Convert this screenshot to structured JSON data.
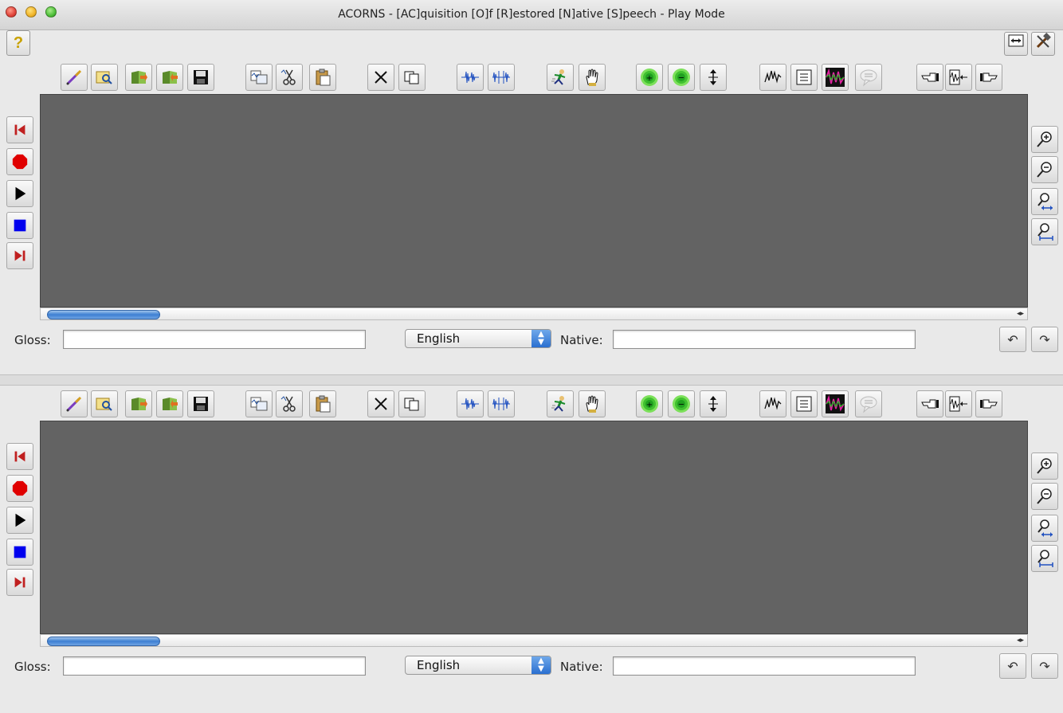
{
  "window": {
    "title": "ACORNS - [AC]quisition [O]f [R]estored [N]ative [S]peech - Play Mode"
  },
  "top_bar": {
    "help_icon": "help-question-icon",
    "fit_icon": "fit-width-icon",
    "tools_icon": "tools-hammer-icon"
  },
  "panels": [
    {
      "gloss_label": "Gloss:",
      "gloss_value": "",
      "language": "English",
      "native_label": "Native:",
      "native_value": ""
    },
    {
      "gloss_label": "Gloss:",
      "gloss_value": "",
      "language": "English",
      "native_label": "Native:",
      "native_value": ""
    }
  ],
  "toolbar_icons": [
    "clear-icon",
    "find-icon",
    "import-icon",
    "export-icon",
    "save-icon",
    "convert-icon",
    "cut-audio-icon",
    "paste-audio-icon",
    "delete-icon",
    "copy-icon",
    "compress-wave-icon",
    "expand-wave-icon",
    "run-icon",
    "hand-icon",
    "amplify-icon",
    "attenuate-icon",
    "normalize-icon",
    "pitch-icon",
    "annotation-icon",
    "spectrum-icon",
    "speech-bubble-icon",
    "point-left-icon",
    "wave-marker-icon",
    "point-right-icon"
  ],
  "playback_icons": [
    "go-start-icon",
    "record-icon",
    "play-icon",
    "stop-icon",
    "go-end-icon"
  ],
  "zoom_icons": [
    "zoom-in-icon",
    "zoom-out-icon",
    "zoom-horizontal-icon",
    "zoom-fit-icon"
  ],
  "colors": {
    "waveform_bg": "#636363",
    "record": "#e00000",
    "stop": "#0000ee",
    "nav": "#b02020",
    "accent": "#3d7fd3"
  }
}
